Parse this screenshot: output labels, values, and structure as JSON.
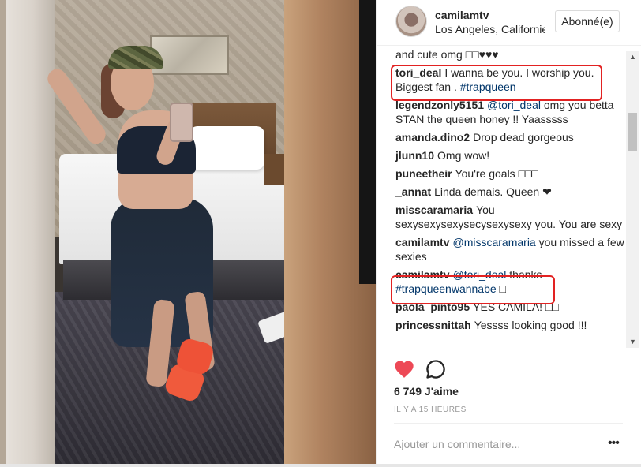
{
  "header": {
    "username": "camilamtv",
    "location": "Los Angeles, Californie",
    "follow_label": "Abonné(e)"
  },
  "comments": [
    {
      "author": "",
      "text": "and cute omg □□♥♥♥"
    },
    {
      "author": "tori_deal",
      "text": "I wanna be you. I worship you. Biggest fan . ",
      "tag": "#trapqueen"
    },
    {
      "author": "legendzonly5151",
      "mention": "@tori_deal",
      "text": " omg you betta STAN the queen honey !! Yaasssss"
    },
    {
      "author": "amanda.dino2",
      "text": "Drop dead gorgeous"
    },
    {
      "author": "jlunn10",
      "text": "Omg wow!"
    },
    {
      "author": "puneetheir",
      "text": "You're goals □□□"
    },
    {
      "author": "_annat",
      "text": "Linda demais. Queen ❤"
    },
    {
      "author": "misscaramaria",
      "text": "You sexysexysexysecysexysexy you. You are sexy"
    },
    {
      "author": "camilamtv",
      "mention": "@misscaramaria",
      "text": " you missed a few sexies"
    },
    {
      "author": "camilamtv",
      "mention": "@tori_deal",
      "text": " thanks ",
      "tag": "#trapqueenwannabe",
      "tail": " □"
    },
    {
      "author": "paola_pinto95",
      "text": "YES CAMILA! □□"
    },
    {
      "author": "princessnittah",
      "text": "Yessss looking good !!!"
    }
  ],
  "actions": {
    "like_icon": "heart-icon",
    "comment_icon": "speech-bubble-icon",
    "like_color": "#ed4956"
  },
  "likes": "6 749 J'aime",
  "timestamp": "IL Y A 15 HEURES",
  "add_comment": {
    "placeholder": "Ajouter un commentaire..."
  },
  "more_label": "•••",
  "colors": {
    "highlight": "#e22222",
    "link": "#003569"
  }
}
